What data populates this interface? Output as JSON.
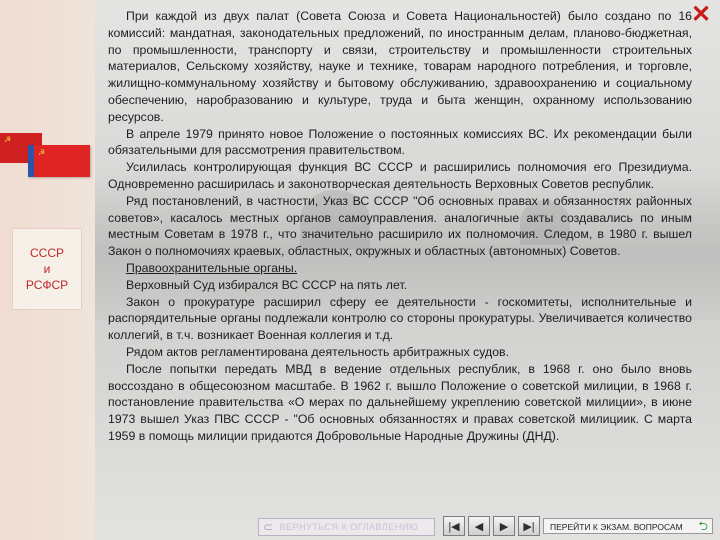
{
  "window": {
    "close_icon": "close-icon",
    "close_symbol": "✕"
  },
  "left_panel": {
    "label_line1": "СССР",
    "label_line2": "и",
    "label_line3": "РСФСР"
  },
  "content": {
    "paragraphs": [
      "При каждой из двух палат (Совета Союза и Совета Национальностей) было создано по 16 комиссий: мандатная, законодательных предложений, по иностранным делам, планово-бюджетная, по промышленности, транспорту и связи, строительству и промышленности строительных материалов, Сельскому хозяйству, науке и технике, товарам народного потребления, и торговле, жилищно-коммунальному хозяйству и бытовому обслуживанию, здравоохранению и социальному обеспечению, наробразованию и культуре, труда и быта женщин, охранному использованию ресурсов.",
      "В апреле 1979 принято новое Положение о постоянных комиссиях ВС. Их рекомендации были обязательными для рассмотрения правительством.",
      "Усилилась контролирующая функция ВС СССР и расширились полномочия его Президиума. Одновременно расширилась и законотворческая деятельность Верховных Советов республик.",
      "Ряд постановлений, в частности, Указ ВС СССР \"Об основных правах и обязанностях районных советов», касалось местных органов самоуправления. аналогичные акты создавались по иным местным Советам в 1978 г., что значительно расширило их полномочия. Следом, в 1980 г. вышел Закон о полномочиях краевых, областных, окружных и областных (автономных) Советов.",
      "Правоохранительные органы.",
      "Верховный Суд избирался ВС СССР на пять лет.",
      "Закон о прокуратуре расширил сферу ее деятельности - госкомитеты, исполнительные и распорядительные органы подлежали контролю со стороны прокуратуры. Увеличивается количество коллегий, в т.ч. возникает Военная коллегия и т.д.",
      "Рядом актов регламентирована деятельность арбитражных судов.",
      "После попытки передать МВД в ведение отдельных республик, в 1968 г. оно было вновь воссоздано в общесоюзном масштабе. В 1962 г. вышло Положение о советской милиции, в 1968 г. постановление правительства «О мерах по дальнейшему укреплению советской милиции», в июне 1973 вышел Указ ПВС СССР - \"Об основных обязанностях и правах советской милициик. С марта 1959 в помощь милиции придаются Добровольные Народные Дружины (ДНД)."
    ]
  },
  "toolbar": {
    "back_label": "ВЕРНУТЬСЯ К ОГЛАВЛЕНИЮ",
    "back_icon": "arrow-left-icon",
    "first_icon": "skip-first-icon",
    "prev_icon": "prev-icon",
    "next_icon": "next-icon",
    "last_icon": "skip-last-icon",
    "exam_label": "ПЕРЕЙТИ К ЭКЗАМ. ВОПРОСАМ",
    "exam_icon": "return-arrow-icon"
  },
  "colors": {
    "accent_red": "#c81a1a",
    "flag_red": "#d51f1f",
    "text": "#1e1e1e"
  }
}
